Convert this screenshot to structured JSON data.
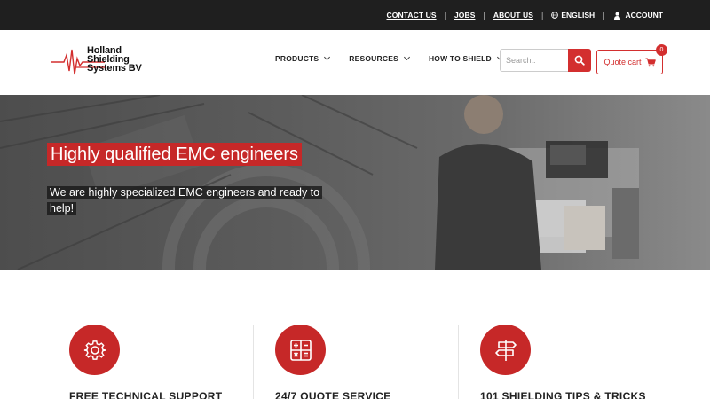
{
  "topbar": {
    "links": [
      "CONTACT US",
      "JOBS",
      "ABOUT US"
    ],
    "language": "ENGLISH",
    "account": "ACCOUNT"
  },
  "header": {
    "logo_lines": [
      "Holland",
      "Shielding",
      "Systems BV"
    ],
    "nav": [
      "PRODUCTS",
      "RESOURCES",
      "HOW TO SHIELD"
    ],
    "search_placeholder": "Search..",
    "quote_label": "Quote cart",
    "quote_count": "0"
  },
  "hero": {
    "title": "Highly qualified EMC engineers",
    "subtitle": "We are highly specialized EMC engineers and ready to help!"
  },
  "features": [
    {
      "title": "FREE TECHNICAL SUPPORT",
      "icon": "gear-icon"
    },
    {
      "title": "24/7 QUOTE SERVICE",
      "icon": "calculator-icon"
    },
    {
      "title": "101 SHIELDING TIPS & TRICKS",
      "icon": "signpost-icon"
    }
  ],
  "colors": {
    "brand_red": "#c62828",
    "topbar": "#1f1f1f"
  }
}
